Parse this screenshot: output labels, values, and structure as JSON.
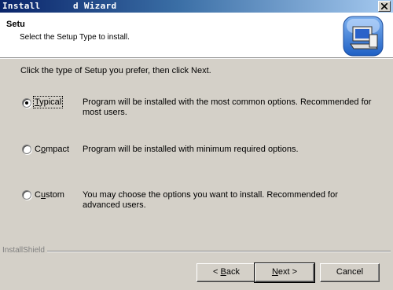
{
  "window": {
    "title": "Install      d Wizard"
  },
  "header": {
    "title": "Setu",
    "subtitle": "Select the Setup Type to install.",
    "icon": "installer-computer-icon"
  },
  "instruction": "Click the type of Setup you prefer, then click Next.",
  "setup_options": [
    {
      "label_prefix": "",
      "label_underlined": "T",
      "label_rest": "ypical",
      "description": "Program will be installed with the most common options.  Recommended for most users.",
      "checked": true
    },
    {
      "label_prefix": "C",
      "label_underlined": "o",
      "label_rest": "mpact",
      "description": "Program will be installed with minimum required options.",
      "checked": false
    },
    {
      "label_prefix": "C",
      "label_underlined": "u",
      "label_rest": "stom",
      "description": "You may choose the options you want to install. Recommended for advanced users.",
      "checked": false
    }
  ],
  "footer": {
    "brand": "InstallShield"
  },
  "buttons": {
    "back": {
      "prefix": "< ",
      "underlined": "B",
      "rest": "ack"
    },
    "next": {
      "prefix": "",
      "underlined": "N",
      "rest": "ext >"
    },
    "cancel": {
      "label": "Cancel"
    }
  },
  "colors": {
    "titlebar_start": "#0a246a",
    "titlebar_end": "#a6caf0",
    "dialog_face": "#d4d0c8"
  }
}
